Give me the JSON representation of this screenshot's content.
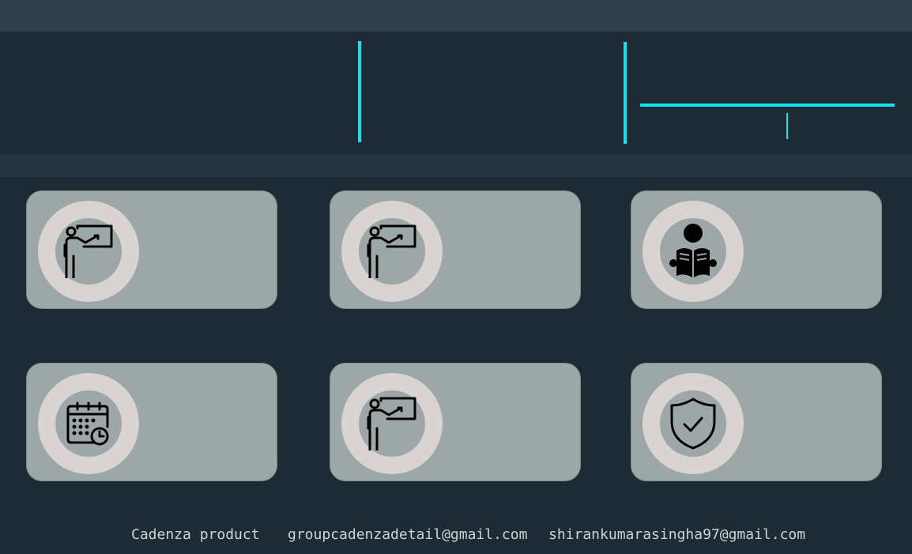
{
  "theme": {
    "background": "#1e2b34",
    "topbar": "#304149",
    "accent": "#11e4ec",
    "card": "#9ea7a8",
    "ring": "#d9d3d2"
  },
  "cards": [
    {
      "icon": "teacher-board-icon"
    },
    {
      "icon": "teacher-board-icon"
    },
    {
      "icon": "reading-student-icon"
    },
    {
      "icon": "calendar-clock-icon"
    },
    {
      "icon": "teacher-board-icon"
    },
    {
      "icon": "shield-check-icon"
    }
  ],
  "footer": {
    "product": "Cadenza product",
    "email_group": "groupcadenzadetail@gmail.com",
    "email_personal": "shirankumarasingha97@gmail.com"
  }
}
